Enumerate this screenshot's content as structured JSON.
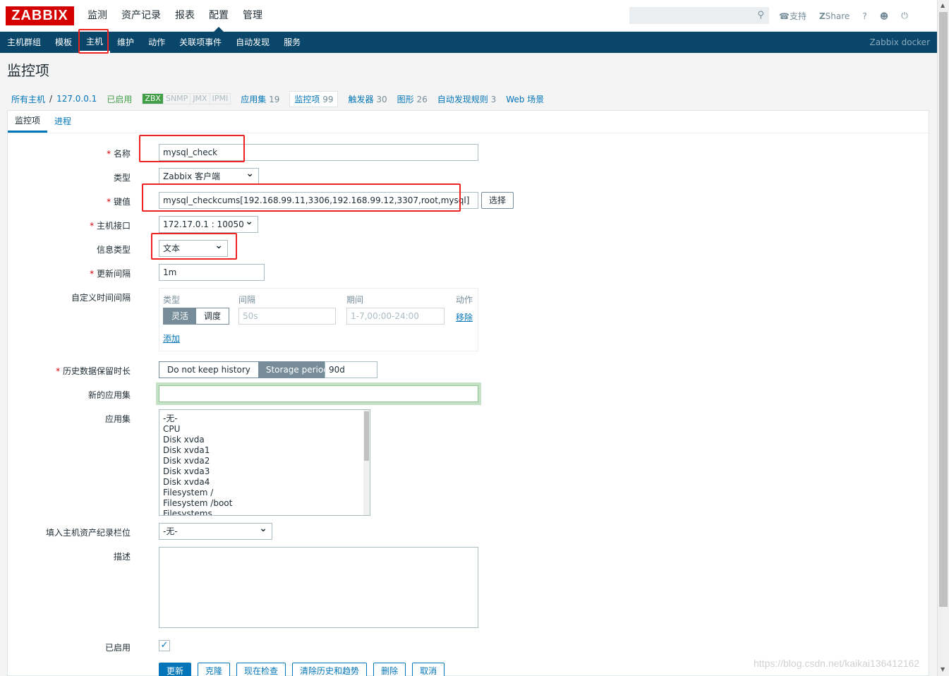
{
  "brand": "ZABBIX",
  "main_nav": [
    "监测",
    "资产记录",
    "报表",
    "配置",
    "管理"
  ],
  "top_links": {
    "support": "支持",
    "share": "Share",
    "help": "?"
  },
  "sub_nav": [
    "主机群组",
    "模板",
    "主机",
    "维护",
    "动作",
    "关联项事件",
    "自动发现",
    "服务"
  ],
  "server_name": "Zabbix docker",
  "page_title": "监控项",
  "breadcrumb": {
    "all_hosts": "所有主机",
    "separator": "/",
    "host": "127.0.0.1",
    "status": "已启用",
    "tags": [
      "ZBX",
      "SNMP",
      "JMX",
      "IPMI"
    ],
    "links": [
      {
        "label": "应用集",
        "count": "19"
      },
      {
        "label": "监控项",
        "count": "99"
      },
      {
        "label": "触发器",
        "count": "30"
      },
      {
        "label": "图形",
        "count": "26"
      },
      {
        "label": "自动发现规则",
        "count": "3"
      },
      {
        "label": "Web 场景",
        "count": ""
      }
    ]
  },
  "tabs": [
    "监控项",
    "进程"
  ],
  "form": {
    "name_label": "名称",
    "name_value": "mysql_check",
    "type_label": "类型",
    "type_value": "Zabbix 客户端",
    "key_label": "键值",
    "key_value": "mysql_checkcums[192.168.99.11,3306,192.168.99.12,3307,root,mysql]",
    "key_button": "选择",
    "interface_label": "主机接口",
    "interface_value": "172.17.0.1 : 10050",
    "info_type_label": "信息类型",
    "info_type_value": "文本",
    "interval_label": "更新间隔",
    "interval_value": "1m",
    "custom_label": "自定义时间间隔",
    "custom_headers": {
      "type": "类型",
      "interval": "间隔",
      "period": "期间",
      "action": "动作"
    },
    "custom_modes": [
      "灵活",
      "调度"
    ],
    "custom_interval_placeholder": "50s",
    "custom_period_placeholder": "1-7,00:00-24:00",
    "custom_remove": "移除",
    "custom_add": "添加",
    "history_label": "历史数据保留时长",
    "history_options": [
      "Do not keep history",
      "Storage period"
    ],
    "history_value": "90d",
    "new_app_label": "新的应用集",
    "new_app_value": "",
    "apps_label": "应用集",
    "apps": [
      "-无-",
      "CPU",
      "Disk xvda",
      "Disk xvda1",
      "Disk xvda2",
      "Disk xvda3",
      "Disk xvda4",
      "Filesystem /",
      "Filesystem /boot",
      "Filesystems"
    ],
    "inventory_label": "填入主机资产纪录栏位",
    "inventory_value": "-无-",
    "desc_label": "描述",
    "desc_value": "",
    "enabled_label": "已启用"
  },
  "actions": [
    "更新",
    "克隆",
    "现在检查",
    "清除历史和趋势",
    "删除",
    "取消"
  ],
  "watermark": "https://blog.csdn.net/kaikai136412162",
  "colors": {
    "brand": "#d40000",
    "nav_bg": "#0a466a",
    "link": "#0275b8",
    "highlight": "#e22222"
  }
}
